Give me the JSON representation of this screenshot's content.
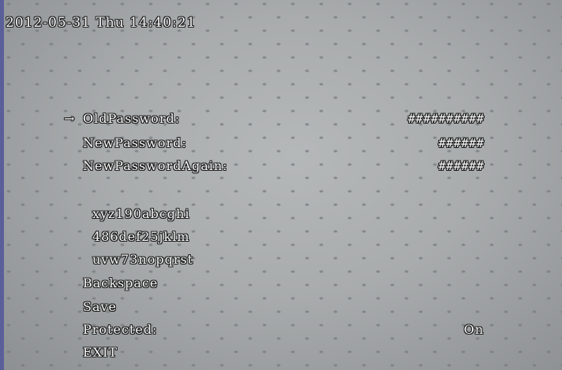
{
  "header": {
    "datetime": "2012-05-31 Thu 14:40:21"
  },
  "menu": {
    "cursor": "→",
    "old_password": {
      "label": "OldPassword:",
      "value": "##########"
    },
    "new_password": {
      "label": "NewPassword:",
      "value": "######"
    },
    "new_password_again": {
      "label": "NewPasswordAgain:",
      "value": "######"
    },
    "keyboard_rows": [
      "xyz190abcghi",
      "486def25jklm",
      "uvw73nopqrst"
    ],
    "backspace": "Backspace",
    "save": "Save",
    "protected": {
      "label": "Protected:",
      "value": "On"
    },
    "exit": "EXIT"
  }
}
